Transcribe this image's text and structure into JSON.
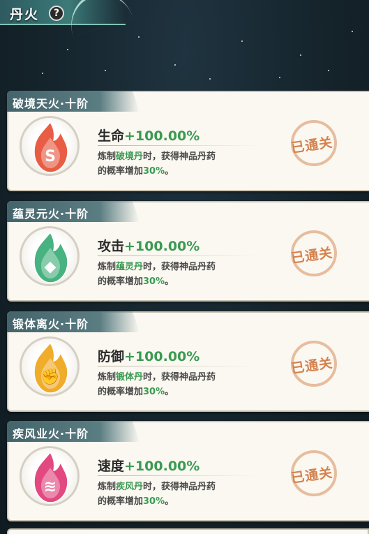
{
  "header": {
    "title": "丹火",
    "help_label": "?"
  },
  "fires": [
    {
      "name": "破境天火·十阶",
      "stat_label": "生命",
      "stat_value": "+100.00%",
      "desc_prefix": "炼制",
      "pill": "破境丹",
      "desc_mid": "时，获得神品丹药",
      "desc_line2_prefix": "的概率增加",
      "percent": "30%",
      "desc_suffix": "。",
      "status": "已通关",
      "color": "#e8553a",
      "icon": "fire-swirl-icon"
    },
    {
      "name": "蕴灵元火·十阶",
      "stat_label": "攻击",
      "stat_value": "+100.00%",
      "desc_prefix": "炼制",
      "pill": "蕴灵丹",
      "desc_mid": "时，获得神品丹药",
      "desc_line2_prefix": "的概率增加",
      "percent": "30%",
      "desc_suffix": "。",
      "status": "已通关",
      "color": "#3fae7a",
      "icon": "fire-drop-icon"
    },
    {
      "name": "锻体离火·十阶",
      "stat_label": "防御",
      "stat_value": "+100.00%",
      "desc_prefix": "炼制",
      "pill": "锻体丹",
      "desc_mid": "时，获得神品丹药",
      "desc_line2_prefix": "的概率增加",
      "percent": "30%",
      "desc_suffix": "。",
      "status": "已通关",
      "color": "#f0a820",
      "icon": "fire-fist-icon"
    },
    {
      "name": "疾风业火·十阶",
      "stat_label": "速度",
      "stat_value": "+100.00%",
      "desc_prefix": "炼制",
      "pill": "疾风丹",
      "desc_mid": "时，获得神品丹药",
      "desc_line2_prefix": "的概率增加",
      "percent": "30%",
      "desc_suffix": "。",
      "status": "已通关",
      "color": "#e0407a",
      "icon": "fire-wind-icon"
    }
  ],
  "colors": {
    "accent_green": "#3a9a52",
    "stamp": "#d4824e"
  }
}
